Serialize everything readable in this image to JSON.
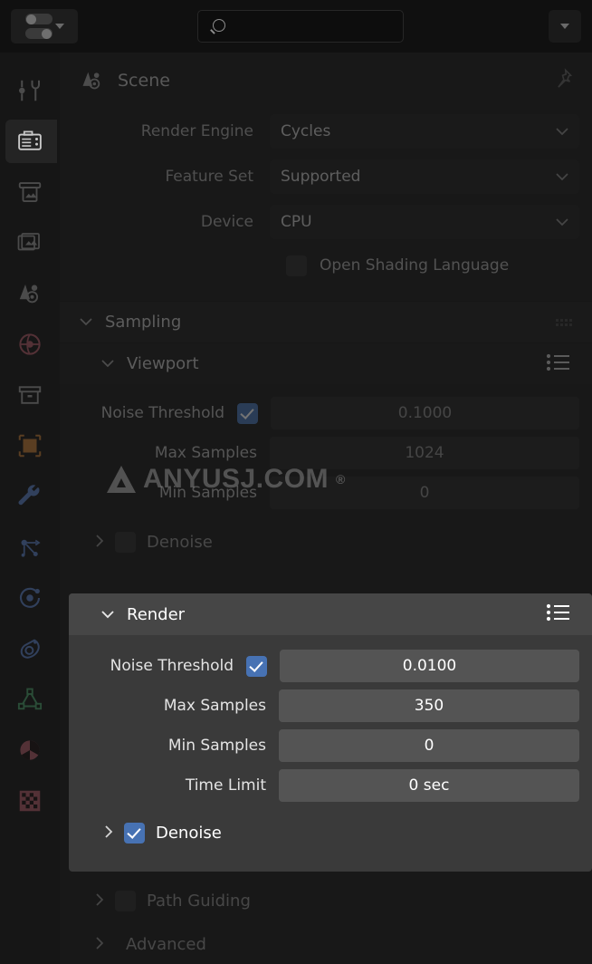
{
  "header": {
    "editor_type_icon": "properties-editor-icon",
    "search_value": "",
    "search_placeholder": "",
    "search_icon": "search-icon",
    "overflow_icon": "chevron-down-icon"
  },
  "breadcrumb": {
    "scene_icon": "scene-icon",
    "label": "Scene",
    "pin_icon": "pin-icon"
  },
  "tabs": [
    {
      "name": "tool",
      "icon": "tool-icon",
      "active": false
    },
    {
      "name": "render",
      "icon": "camera-icon",
      "active": true
    },
    {
      "name": "output",
      "icon": "printer-icon",
      "active": false
    },
    {
      "name": "view-layer",
      "icon": "images-icon",
      "active": false
    },
    {
      "name": "scene",
      "icon": "scene-icon",
      "active": false
    },
    {
      "name": "world",
      "icon": "world-icon",
      "active": false
    },
    {
      "name": "collection",
      "icon": "collection-box-icon",
      "active": false
    },
    {
      "name": "object",
      "icon": "object-square-icon",
      "active": false
    },
    {
      "name": "modifiers",
      "icon": "wrench-icon",
      "active": false
    },
    {
      "name": "particles",
      "icon": "particles-icon",
      "active": false
    },
    {
      "name": "physics",
      "icon": "physics-orbit-icon",
      "active": false
    },
    {
      "name": "object-constraints",
      "icon": "constraints-icon",
      "active": false
    },
    {
      "name": "object-data",
      "icon": "mesh-data-icon",
      "active": false
    },
    {
      "name": "material",
      "icon": "material-sphere-icon",
      "active": false
    },
    {
      "name": "texture",
      "icon": "texture-checker-icon",
      "active": false
    }
  ],
  "render_settings": {
    "engine": {
      "label": "Render Engine",
      "value": "Cycles"
    },
    "feature_set": {
      "label": "Feature Set",
      "value": "Supported"
    },
    "device": {
      "label": "Device",
      "value": "CPU"
    },
    "osl": {
      "label": "Open Shading Language",
      "checked": false
    }
  },
  "sampling": {
    "title": "Sampling",
    "viewport": {
      "title": "Viewport",
      "noise_threshold": {
        "label": "Noise Threshold",
        "checked": true,
        "value": "0.1000"
      },
      "max_samples": {
        "label": "Max Samples",
        "value": "1024"
      },
      "min_samples": {
        "label": "Min Samples",
        "value": "0"
      },
      "denoise": {
        "label": "Denoise",
        "checked": false
      }
    },
    "render": {
      "title": "Render",
      "noise_threshold": {
        "label": "Noise Threshold",
        "checked": true,
        "value": "0.0100"
      },
      "max_samples": {
        "label": "Max Samples",
        "value": "350"
      },
      "min_samples": {
        "label": "Min Samples",
        "value": "0"
      },
      "time_limit": {
        "label": "Time Limit",
        "value": "0 sec"
      },
      "denoise": {
        "label": "Denoise",
        "checked": true
      }
    }
  },
  "panels": {
    "path_guiding": {
      "label": "Path Guiding",
      "checked": false
    },
    "advanced": {
      "label": "Advanced"
    }
  },
  "watermark": {
    "text": "ANYUSJ.COM",
    "registered": "®"
  },
  "colors": {
    "accent_blue": "#4772b3",
    "panel_bg": "#181818",
    "highlight_bg": "#3a3a3a",
    "field_bg": "#3b3b3b"
  }
}
